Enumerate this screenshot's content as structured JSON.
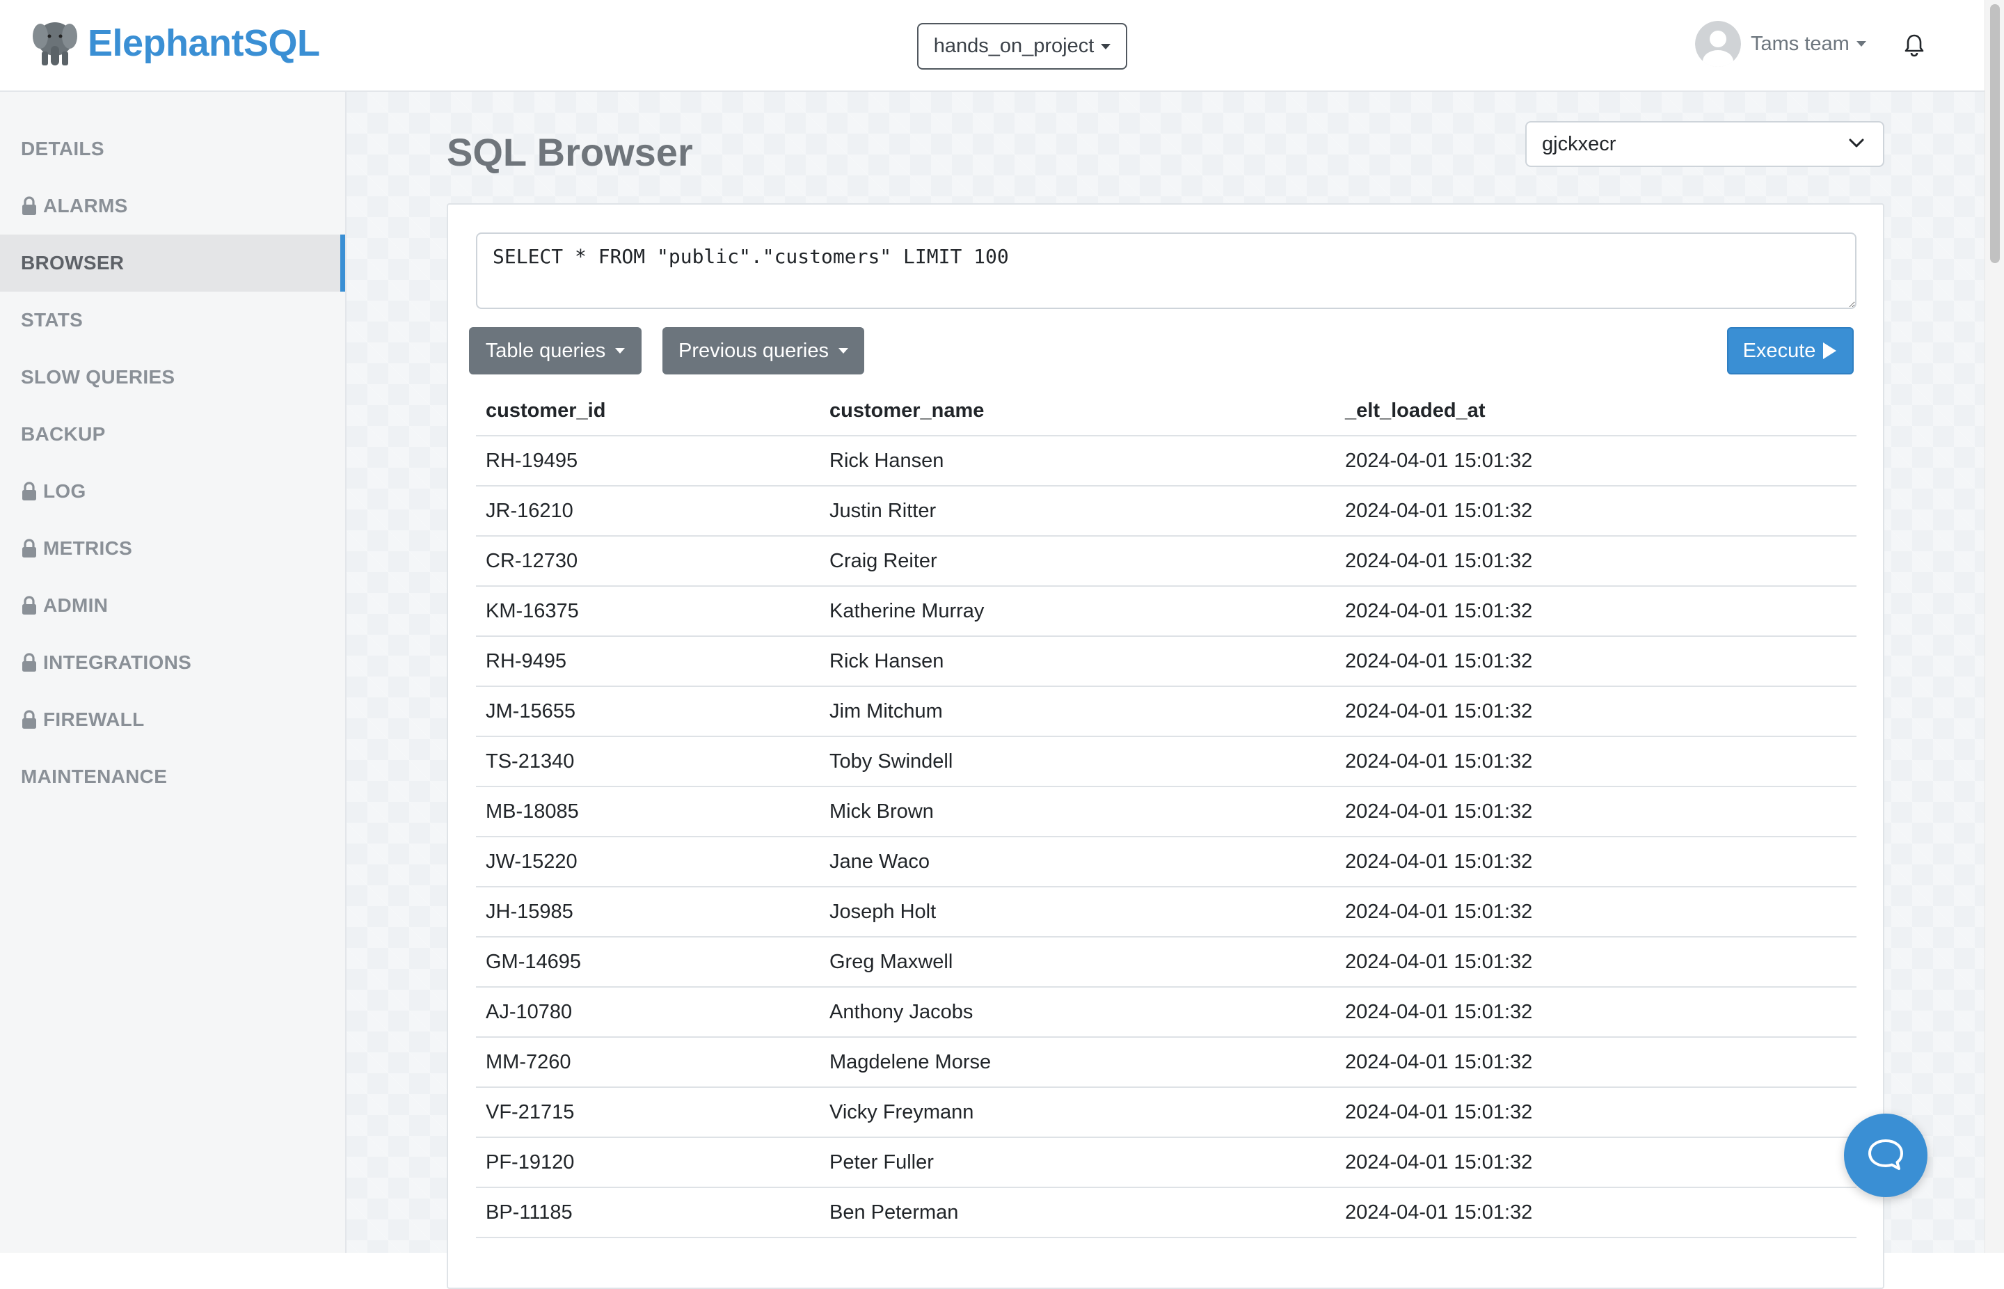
{
  "brand": {
    "name": "ElephantSQL",
    "accent": "#3a8fd4"
  },
  "header": {
    "project": "hands_on_project",
    "user": "Tams team"
  },
  "sidebar": {
    "items": [
      {
        "label": "DETAILS",
        "locked": false,
        "active": false
      },
      {
        "label": "ALARMS",
        "locked": true,
        "active": false
      },
      {
        "label": "BROWSER",
        "locked": false,
        "active": true
      },
      {
        "label": "STATS",
        "locked": false,
        "active": false
      },
      {
        "label": "SLOW QUERIES",
        "locked": false,
        "active": false
      },
      {
        "label": "BACKUP",
        "locked": false,
        "active": false
      },
      {
        "label": "LOG",
        "locked": true,
        "active": false
      },
      {
        "label": "METRICS",
        "locked": true,
        "active": false
      },
      {
        "label": "ADMIN",
        "locked": true,
        "active": false
      },
      {
        "label": "INTEGRATIONS",
        "locked": true,
        "active": false
      },
      {
        "label": "FIREWALL",
        "locked": true,
        "active": false
      },
      {
        "label": "MAINTENANCE",
        "locked": false,
        "active": false
      }
    ]
  },
  "main": {
    "title": "SQL Browser",
    "database": "gjckxecr",
    "query": "SELECT * FROM \"public\".\"customers\" LIMIT 100",
    "buttons": {
      "table_queries": "Table queries",
      "previous_queries": "Previous queries",
      "execute": "Execute"
    },
    "table": {
      "columns": [
        "customer_id",
        "customer_name",
        "_elt_loaded_at"
      ],
      "rows": [
        [
          "RH-19495",
          "Rick Hansen",
          "2024-04-01 15:01:32"
        ],
        [
          "JR-16210",
          "Justin Ritter",
          "2024-04-01 15:01:32"
        ],
        [
          "CR-12730",
          "Craig Reiter",
          "2024-04-01 15:01:32"
        ],
        [
          "KM-16375",
          "Katherine Murray",
          "2024-04-01 15:01:32"
        ],
        [
          "RH-9495",
          "Rick Hansen",
          "2024-04-01 15:01:32"
        ],
        [
          "JM-15655",
          "Jim Mitchum",
          "2024-04-01 15:01:32"
        ],
        [
          "TS-21340",
          "Toby Swindell",
          "2024-04-01 15:01:32"
        ],
        [
          "MB-18085",
          "Mick Brown",
          "2024-04-01 15:01:32"
        ],
        [
          "JW-15220",
          "Jane Waco",
          "2024-04-01 15:01:32"
        ],
        [
          "JH-15985",
          "Joseph Holt",
          "2024-04-01 15:01:32"
        ],
        [
          "GM-14695",
          "Greg Maxwell",
          "2024-04-01 15:01:32"
        ],
        [
          "AJ-10780",
          "Anthony Jacobs",
          "2024-04-01 15:01:32"
        ],
        [
          "MM-7260",
          "Magdelene Morse",
          "2024-04-01 15:01:32"
        ],
        [
          "VF-21715",
          "Vicky Freymann",
          "2024-04-01 15:01:32"
        ],
        [
          "PF-19120",
          "Peter Fuller",
          "2024-04-01 15:01:32"
        ],
        [
          "BP-11185",
          "Ben Peterman",
          "2024-04-01 15:01:32"
        ]
      ]
    }
  },
  "icons": {
    "logo": "elephant-logo-icon",
    "lock": "lock-icon",
    "bell": "bell-icon",
    "chat": "chat-bubble-icon"
  }
}
